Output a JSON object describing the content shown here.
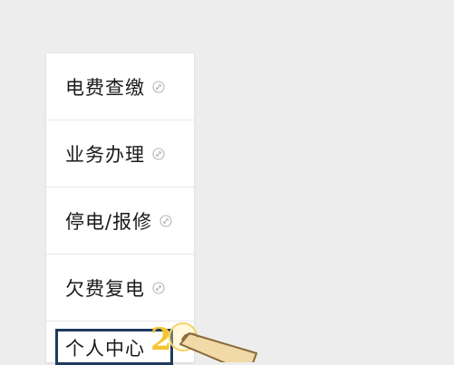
{
  "menu": {
    "items": [
      {
        "label": "电费查缴",
        "icon": "link-icon"
      },
      {
        "label": "业务办理",
        "icon": "link-icon"
      },
      {
        "label": "停电/报修",
        "icon": "link-icon"
      },
      {
        "label": "欠费复电",
        "icon": "link-icon"
      },
      {
        "label": "个人中心",
        "icon": ""
      }
    ],
    "highlighted_index": 4
  },
  "annotation": {
    "step": "2",
    "highlight_color": "#1f3a5f",
    "badge_color": "#f4c430"
  },
  "colors": {
    "background": "#ededed",
    "panel": "#ffffff",
    "text": "#1a1a1a",
    "icon": "#b5b5b5"
  }
}
